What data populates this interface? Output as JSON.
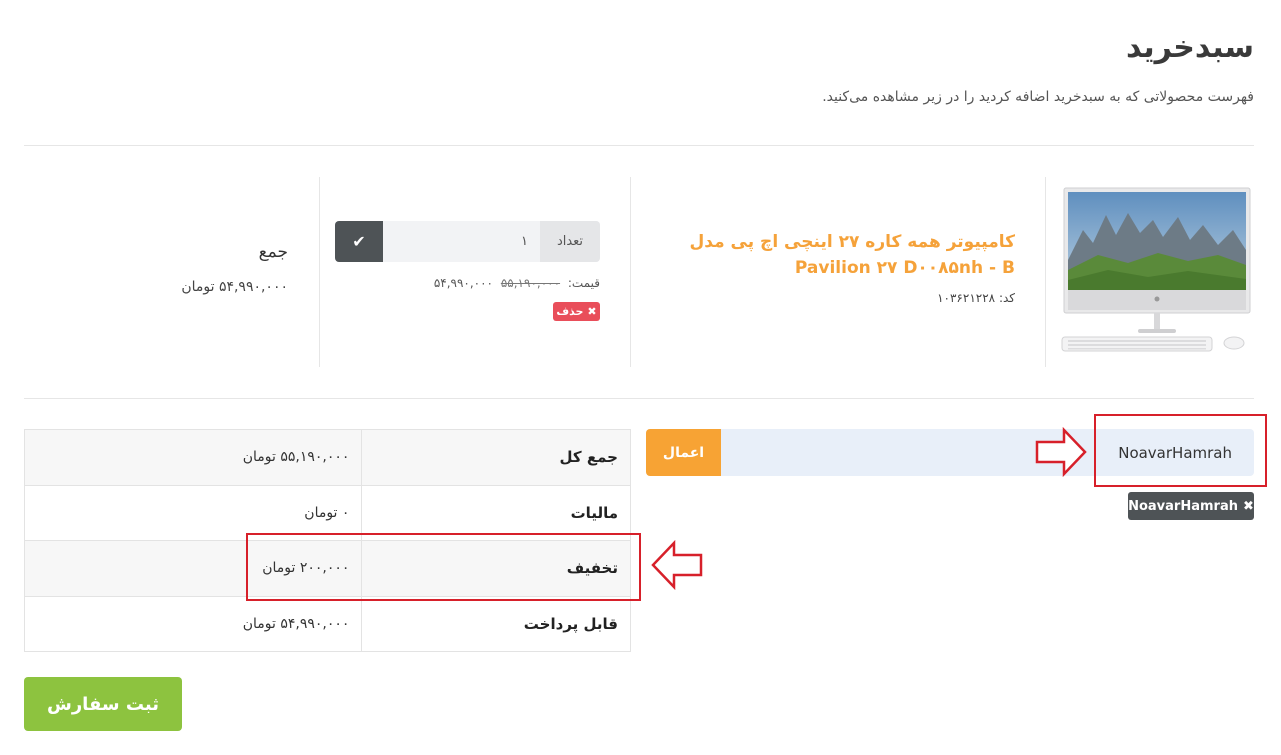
{
  "header": {
    "title": "سبدخرید",
    "subtitle": "فهرست محصولاتی که به سبدخرید اضافه کردید را در زیر مشاهده می‌کنید."
  },
  "product": {
    "name": "کامپیوتر همه کاره ۲۷ اینچی اچ پی مدل Pavilion ۲۷ D۰۰۸۵nh - B",
    "code_label": "کد:",
    "code": "۱۰۳۶۲۱۲۲۸",
    "image_icon": "all-in-one-computer-image"
  },
  "quantity": {
    "label": "تعداد",
    "value": "۱",
    "confirm_icon": "check-icon"
  },
  "price": {
    "label": "قیمت:",
    "old": "۵۵,۱۹۰,۰۰۰",
    "new": "۵۴,۹۹۰,۰۰۰"
  },
  "delete": {
    "label": "حذف",
    "icon": "x-icon"
  },
  "line_total": {
    "label": "جمع",
    "value": "۵۴,۹۹۰,۰۰۰ تومان"
  },
  "totals": {
    "rows": [
      {
        "label": "جمع کل",
        "value": "۵۵,۱۹۰,۰۰۰ تومان"
      },
      {
        "label": "مالیات",
        "value": "۰ تومان"
      },
      {
        "label": "تخفیف",
        "value": "۲۰۰,۰۰۰ تومان"
      },
      {
        "label": "قابل پرداخت",
        "value": "۵۴,۹۹۰,۰۰۰ تومان"
      }
    ]
  },
  "coupon": {
    "value": "NoavarHamrah",
    "apply_label": "اعمال",
    "applied_tag": "NoavarHamrah",
    "tag_icon": "x-icon"
  },
  "submit": {
    "label": "ثبت سفارش"
  },
  "colors": {
    "accent_orange": "#f7a334",
    "danger_red": "#e94e5a",
    "success_green": "#8dc33f",
    "annotation_red": "#d7202a"
  }
}
